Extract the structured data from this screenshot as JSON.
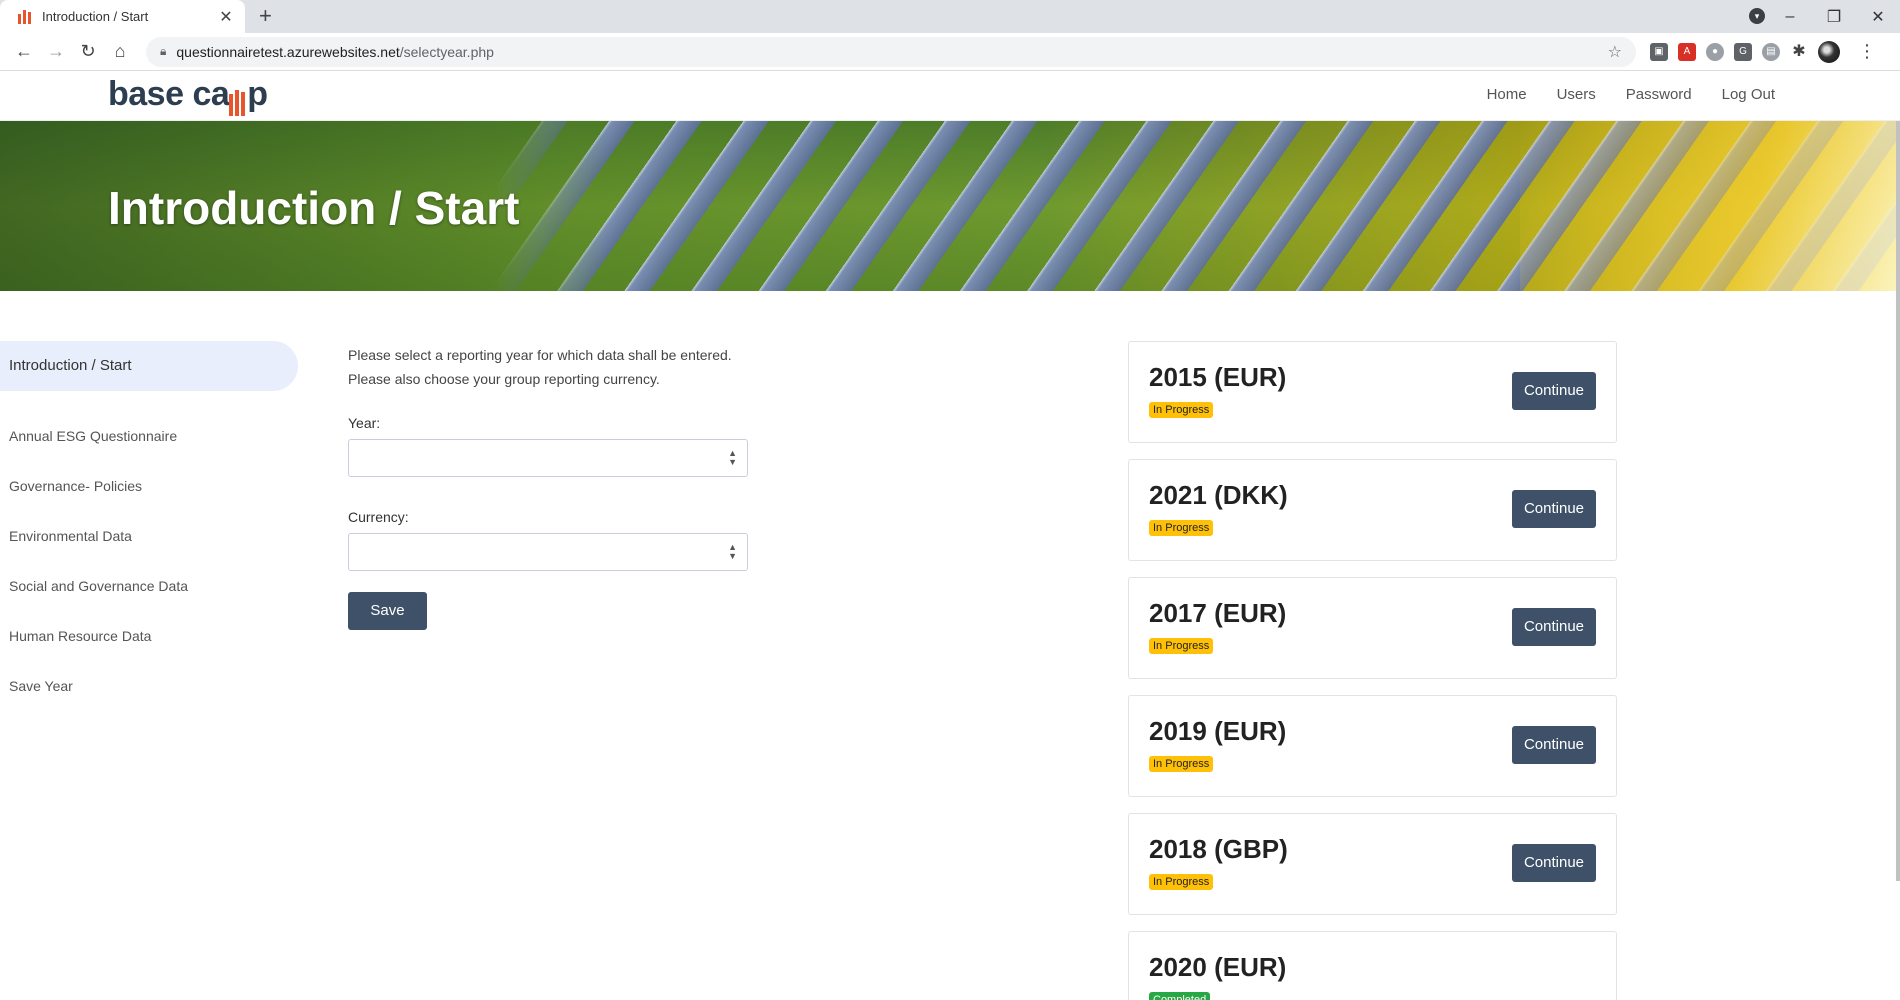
{
  "browser": {
    "tab_title": "Introduction / Start",
    "url_host": "questionnairetest.azurewebsites.net",
    "url_path": "/selectyear.php"
  },
  "site": {
    "logo_text_a": "base ca",
    "logo_text_b": "p",
    "nav": [
      "Home",
      "Users",
      "Password",
      "Log Out"
    ]
  },
  "banner": {
    "title": "Introduction / Start"
  },
  "sidebar": {
    "items": [
      "Introduction / Start",
      "Annual ESG Questionnaire",
      "Governance- Policies",
      "Environmental Data",
      "Social and Governance Data",
      "Human Resource Data",
      "Save Year"
    ]
  },
  "form": {
    "intro_line1": "Please select a reporting year for which data shall be entered.",
    "intro_line2": "Please also choose your group reporting currency.",
    "year_label": "Year:",
    "year_value": "",
    "currency_label": "Currency:",
    "currency_value": "",
    "save_label": "Save"
  },
  "cards": [
    {
      "title": "2015 (EUR)",
      "status": "In Progress",
      "action": "Continue"
    },
    {
      "title": "2021 (DKK)",
      "status": "In Progress",
      "action": "Continue"
    },
    {
      "title": "2017 (EUR)",
      "status": "In Progress",
      "action": "Continue"
    },
    {
      "title": "2019 (EUR)",
      "status": "In Progress",
      "action": "Continue"
    },
    {
      "title": "2018 (GBP)",
      "status": "In Progress",
      "action": "Continue"
    },
    {
      "title": "2020 (EUR)",
      "status": "Completed",
      "action": ""
    }
  ],
  "colors": {
    "accent": "#3e5168",
    "progress": "#ffc107",
    "completed": "#28a745",
    "logo_bars": "#e8542b"
  }
}
